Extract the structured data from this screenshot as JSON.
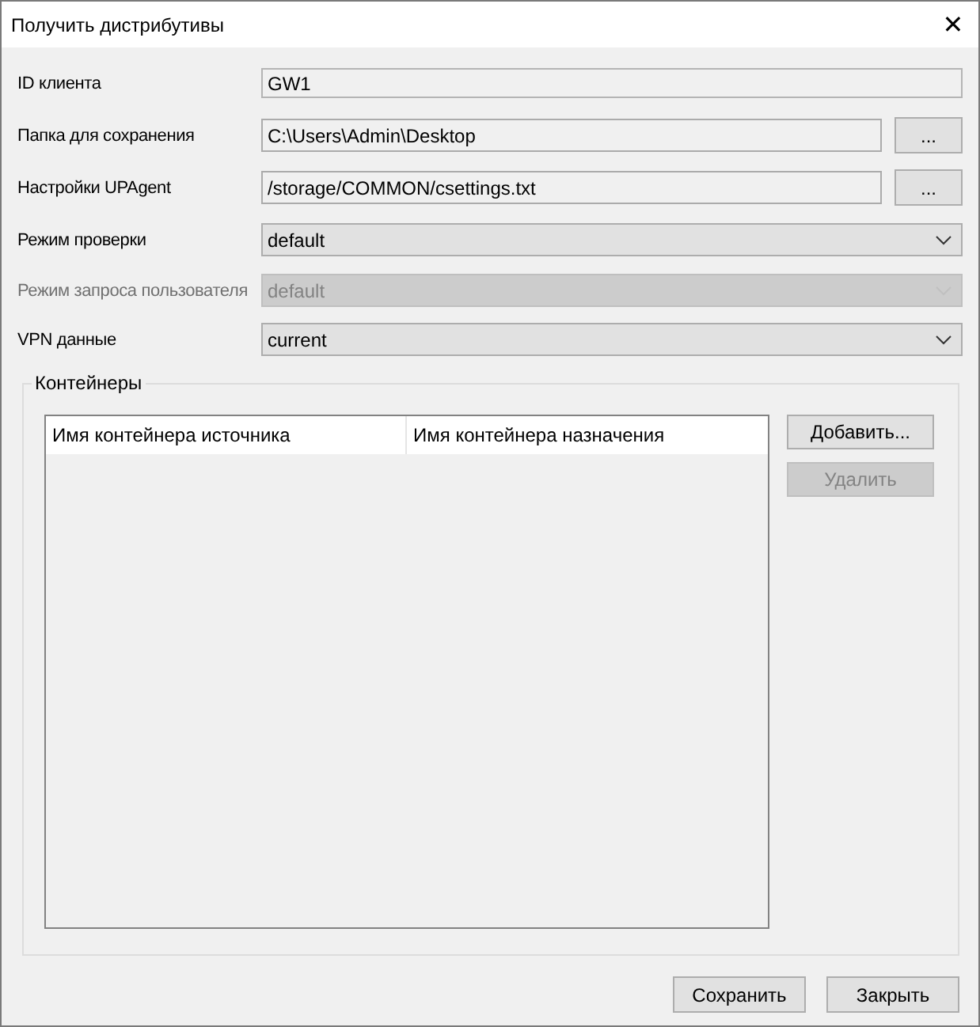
{
  "window": {
    "title": "Получить дистрибутивы",
    "close": "✕"
  },
  "fields": [
    {
      "kind": "text",
      "label": "ID клиента",
      "value": "GW1",
      "disabled": false
    },
    {
      "kind": "file",
      "label": "Папка для сохранения",
      "value": "C:\\Users\\Admin\\Desktop",
      "button": "...",
      "disabled": false
    },
    {
      "kind": "file",
      "label": "Настройки UPAgent",
      "value": "/storage/COMMON/csettings.txt",
      "button": "...",
      "disabled": false
    },
    {
      "kind": "select",
      "label": "Режим проверки",
      "value": "default",
      "disabled": false
    },
    {
      "kind": "select",
      "label": "Режим запроса пользователя",
      "value": "default",
      "disabled": true
    },
    {
      "kind": "select",
      "label": "VPN данные",
      "value": "current",
      "disabled": false
    }
  ],
  "containers": {
    "title": "Контейнеры",
    "columns": [
      "Имя контейнера источника",
      "Имя контейнера назначения"
    ],
    "buttons": [
      {
        "label": "Добавить...",
        "disabled": false
      },
      {
        "label": "Удалить",
        "disabled": true
      }
    ]
  },
  "footer_buttons": [
    "Сохранить",
    "Закрыть"
  ]
}
